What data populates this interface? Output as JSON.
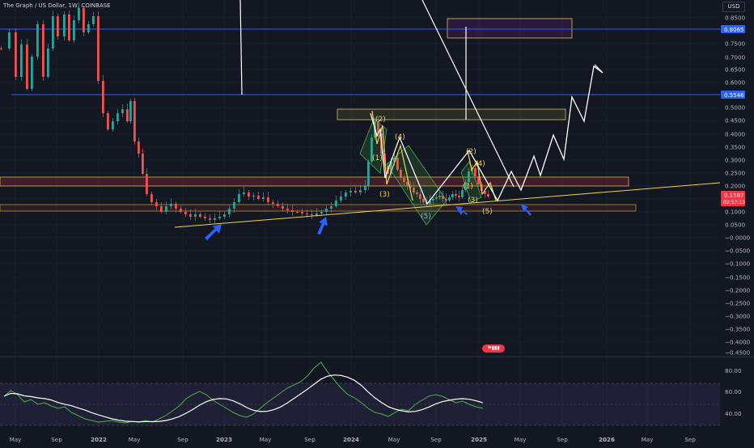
{
  "header": {
    "title": "The Graph / US Dollar, 1W, COINBASE",
    "currency": "USD"
  },
  "price_axis": {
    "ticks": [
      "0.8500",
      "0.7500",
      "0.7000",
      "0.6500",
      "0.6000",
      "0.5000",
      "0.4500",
      "0.4000",
      "0.3500",
      "0.3000",
      "0.2500",
      "0.2000",
      "0.1500",
      "0.1000",
      "0.0500",
      "−0.0000",
      "−0.0500",
      "−0.1000",
      "−0.1500",
      "−0.2000",
      "−0.2500",
      "−0.3000",
      "−0.3500",
      "−0.4000",
      "−0.4500"
    ],
    "levels": {
      "upper_blue": "0.8065",
      "lower_blue": "0.5546",
      "current_price": "0.1587",
      "countdown": "02:57:13"
    }
  },
  "time_axis": {
    "labels": [
      "May",
      "Sep",
      "2022",
      "May",
      "Sep",
      "2023",
      "May",
      "Sep",
      "2024",
      "May",
      "Sep",
      "2025",
      "May",
      "Sep",
      "2026",
      "May",
      "Sep"
    ]
  },
  "indicator": {
    "ticks": [
      "80.00",
      "60.00",
      "40.00"
    ]
  },
  "wave_labels": [
    "(2)",
    "(1)",
    "(4)",
    "(3)",
    "(5)",
    "(2)",
    "(4)",
    "(1)",
    "(3)",
    "(5)"
  ],
  "events_badge": "",
  "colors": {
    "background": "#131722",
    "bull_candle": "#26a69a",
    "bear_candle": "#ef5350",
    "blue_level": "#2962ff",
    "trendline": "#f0d44a",
    "current_price": "#f23645",
    "rsi": "#4caf50",
    "rsi_ma": "#ffffff"
  }
}
